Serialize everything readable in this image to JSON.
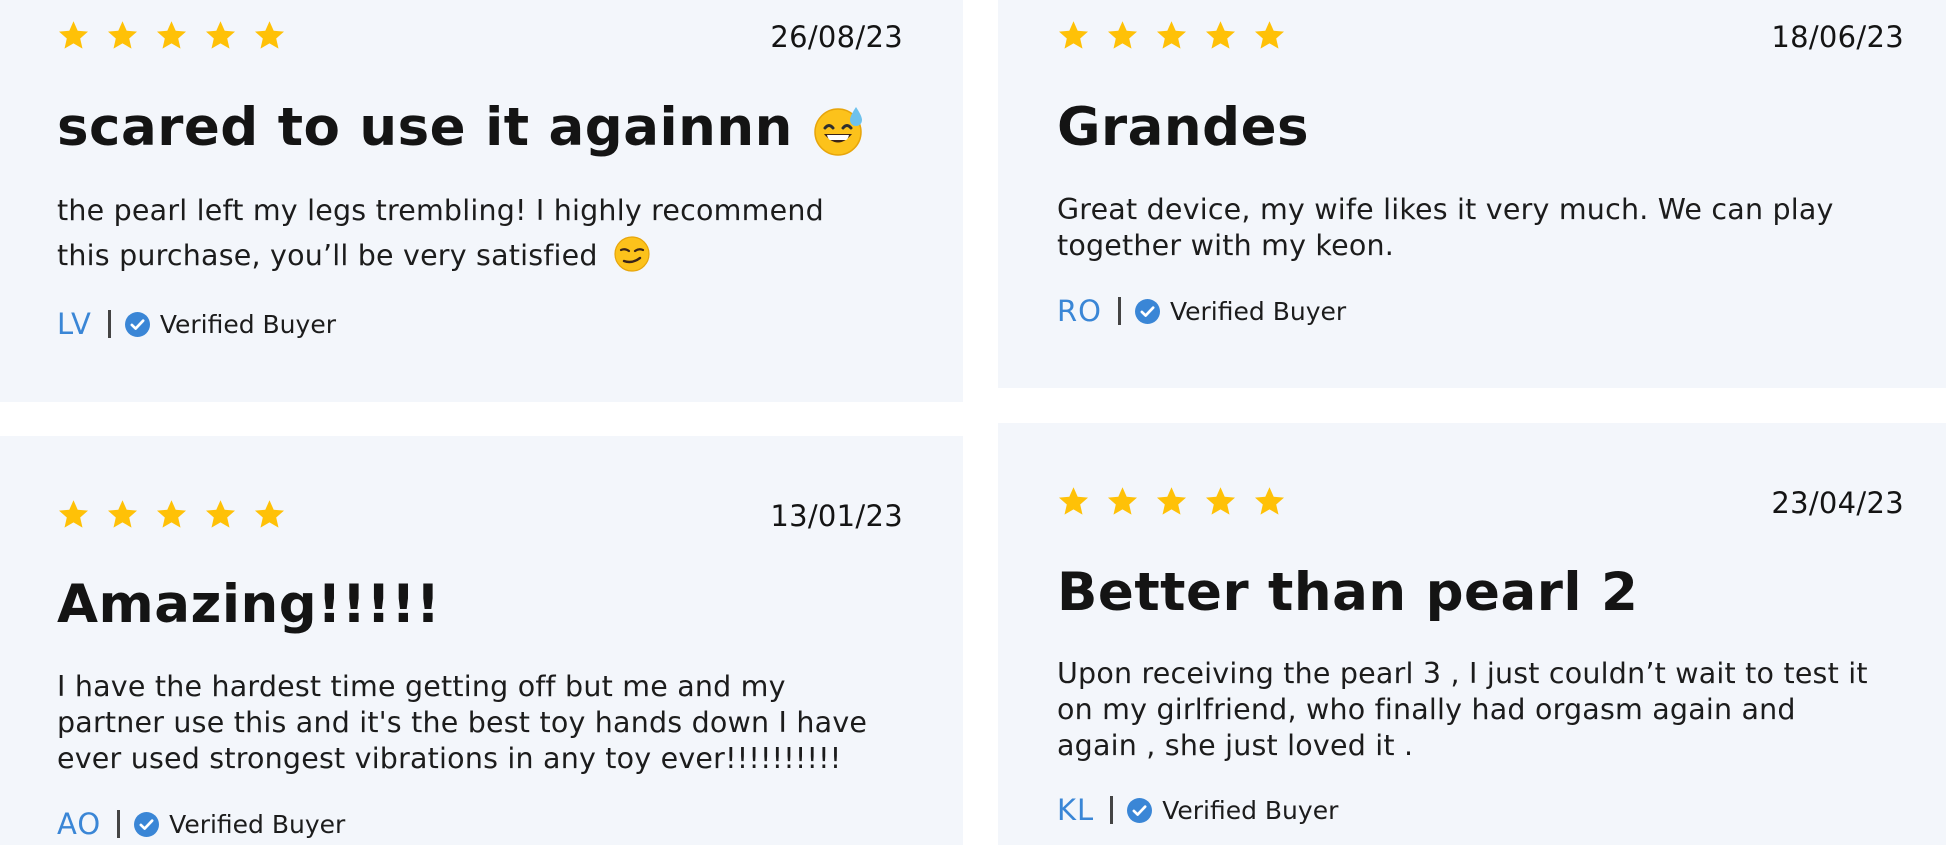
{
  "colors": {
    "card_background": "#f3f6fb",
    "star": "#ffc107",
    "initials": "#3a86d6",
    "verified_badge": "#3a86d6"
  },
  "reviews": [
    {
      "rating": 5,
      "date": "26/08/23",
      "title": "scared to use it againnn",
      "title_emoji": "sweat-smile-emoji",
      "body_lines": [
        "the pearl left my legs trembling! I highly recommend",
        "this purchase, you’ll be very satisfied"
      ],
      "body_emoji": "smirk-emoji",
      "initials": "LV",
      "badge": "Verified Buyer"
    },
    {
      "rating": 5,
      "date": "18/06/23",
      "title": "Grandes",
      "body_lines": [
        "Great device, my wife likes it very much. We can play",
        "together with my keon."
      ],
      "initials": "RO",
      "badge": "Verified Buyer"
    },
    {
      "rating": 5,
      "date": "13/01/23",
      "title": "Amazing!!!!!",
      "body_lines": [
        "I have the hardest time getting off but me and my",
        "partner use this and it's the best toy hands down I have",
        "ever used strongest vibrations in any toy ever!!!!!!!!!!"
      ],
      "initials": "AO",
      "badge": "Verified Buyer"
    },
    {
      "rating": 5,
      "date": "23/04/23",
      "title": "Better than pearl 2",
      "body_lines": [
        "Upon receiving the pearl 3 , I just couldn’t wait to test it",
        "on my girlfriend, who finally had orgasm again and",
        "again , she just loved it ."
      ],
      "initials": "KL",
      "badge": "Verified Buyer"
    }
  ]
}
